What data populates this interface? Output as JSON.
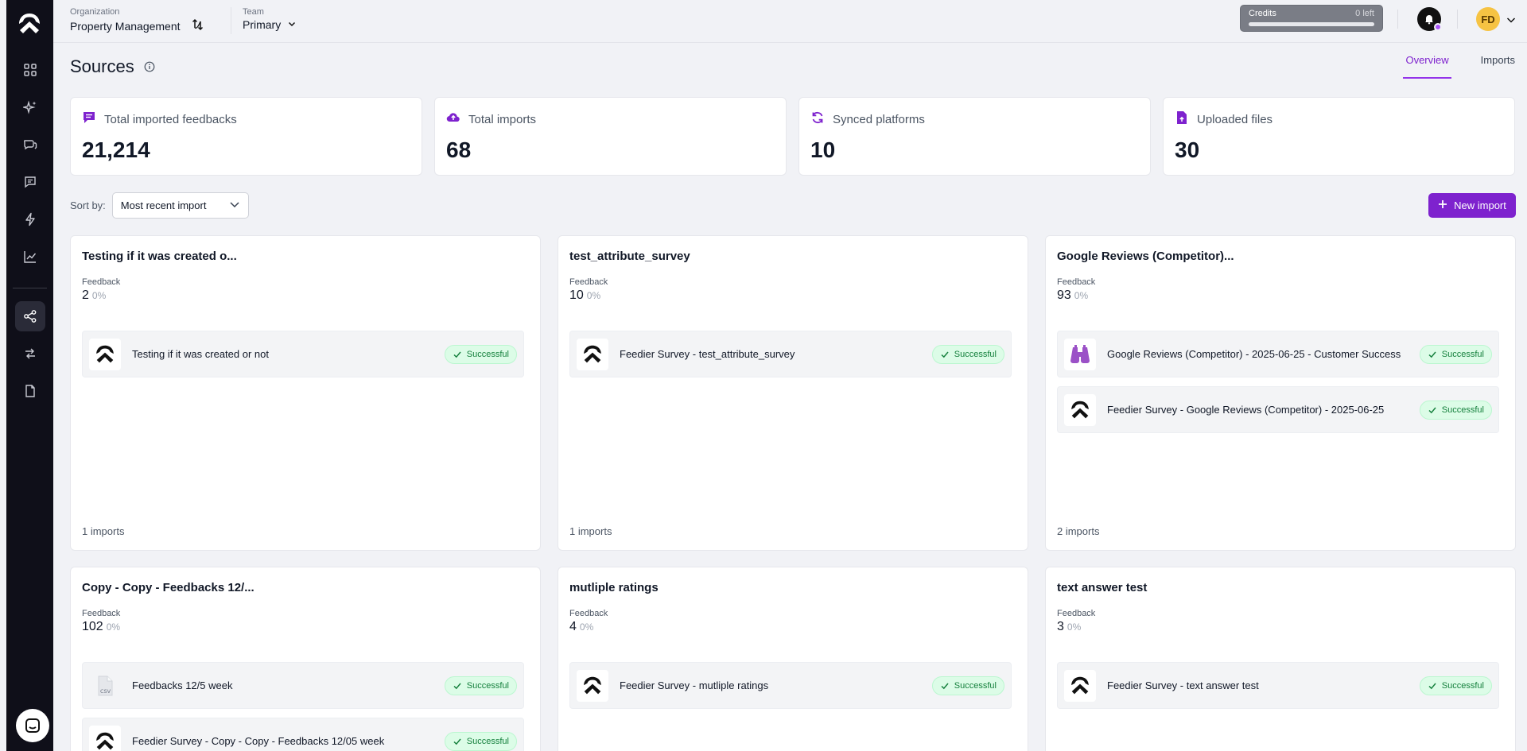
{
  "header": {
    "organization_label": "Organization",
    "organization_name": "Property Management",
    "team_label": "Team",
    "team_name": "Primary",
    "credits_label": "Credits",
    "credits_left": "0 left",
    "credits_used_fraction": 0,
    "avatar_initials": "FD",
    "accent_color": "#7e22ce"
  },
  "sidebar": {
    "items": [
      {
        "icon": "dashboard-icon"
      },
      {
        "icon": "sparkles-icon"
      },
      {
        "icon": "conversations-icon"
      },
      {
        "icon": "feedback-icon"
      },
      {
        "icon": "lightning-icon"
      },
      {
        "icon": "chart-icon"
      },
      {
        "icon": "sources-icon",
        "active": true
      },
      {
        "icon": "integrations-icon"
      },
      {
        "icon": "document-icon"
      }
    ]
  },
  "page": {
    "title": "Sources",
    "tabs": [
      {
        "label": "Overview",
        "active": true
      },
      {
        "label": "Imports",
        "active": false
      }
    ]
  },
  "stats": [
    {
      "label": "Total imported feedbacks",
      "value": "21,214",
      "icon": "feedback-icon"
    },
    {
      "label": "Total imports",
      "value": "68",
      "icon": "cloud-upload-icon"
    },
    {
      "label": "Synced platforms",
      "value": "10",
      "icon": "sync-icon"
    },
    {
      "label": "Uploaded files",
      "value": "30",
      "icon": "file-upload-icon"
    }
  ],
  "sort": {
    "label": "Sort by:",
    "selected": "Most recent import"
  },
  "new_import_label": "New import",
  "cards": [
    {
      "title": "Testing if it was created o...",
      "feedback_label": "Feedback",
      "feedback_count": "2",
      "feedback_pct": "0%",
      "imports": [
        {
          "name": "Testing if it was created or not",
          "status": "Successful",
          "icon": "feedier-logo-icon"
        }
      ],
      "footer": "1 imports"
    },
    {
      "title": "test_attribute_survey",
      "feedback_label": "Feedback",
      "feedback_count": "10",
      "feedback_pct": "0%",
      "imports": [
        {
          "name": "Feedier Survey - test_attribute_survey",
          "status": "Successful",
          "icon": "feedier-logo-icon"
        }
      ],
      "footer": "1 imports"
    },
    {
      "title": "Google Reviews (Competitor)...",
      "feedback_label": "Feedback",
      "feedback_count": "93",
      "feedback_pct": "0%",
      "imports": [
        {
          "name": "Google Reviews (Competitor) - 2025-06-25 - Customer Success",
          "status": "Successful",
          "icon": "binoculars-icon"
        },
        {
          "name": "Feedier Survey - Google Reviews (Competitor) - 2025-06-25",
          "status": "Successful",
          "icon": "feedier-logo-icon"
        }
      ],
      "footer": "2 imports"
    },
    {
      "title": "Copy - Copy - Feedbacks 12/...",
      "feedback_label": "Feedback",
      "feedback_count": "102",
      "feedback_pct": "0%",
      "imports": [
        {
          "name": "Feedbacks 12/5 week",
          "status": "Successful",
          "icon": "csv-file-icon"
        },
        {
          "name": "Feedier Survey - Copy - Copy - Feedbacks 12/05 week",
          "status": "Successful",
          "icon": "feedier-logo-icon"
        }
      ],
      "footer": ""
    },
    {
      "title": "mutliple ratings",
      "feedback_label": "Feedback",
      "feedback_count": "4",
      "feedback_pct": "0%",
      "imports": [
        {
          "name": "Feedier Survey - mutliple ratings",
          "status": "Successful",
          "icon": "feedier-logo-icon"
        }
      ],
      "footer": ""
    },
    {
      "title": "text answer test",
      "feedback_label": "Feedback",
      "feedback_count": "3",
      "feedback_pct": "0%",
      "imports": [
        {
          "name": "Feedier Survey - text answer test",
          "status": "Successful",
          "icon": "feedier-logo-icon"
        }
      ],
      "footer": ""
    }
  ]
}
